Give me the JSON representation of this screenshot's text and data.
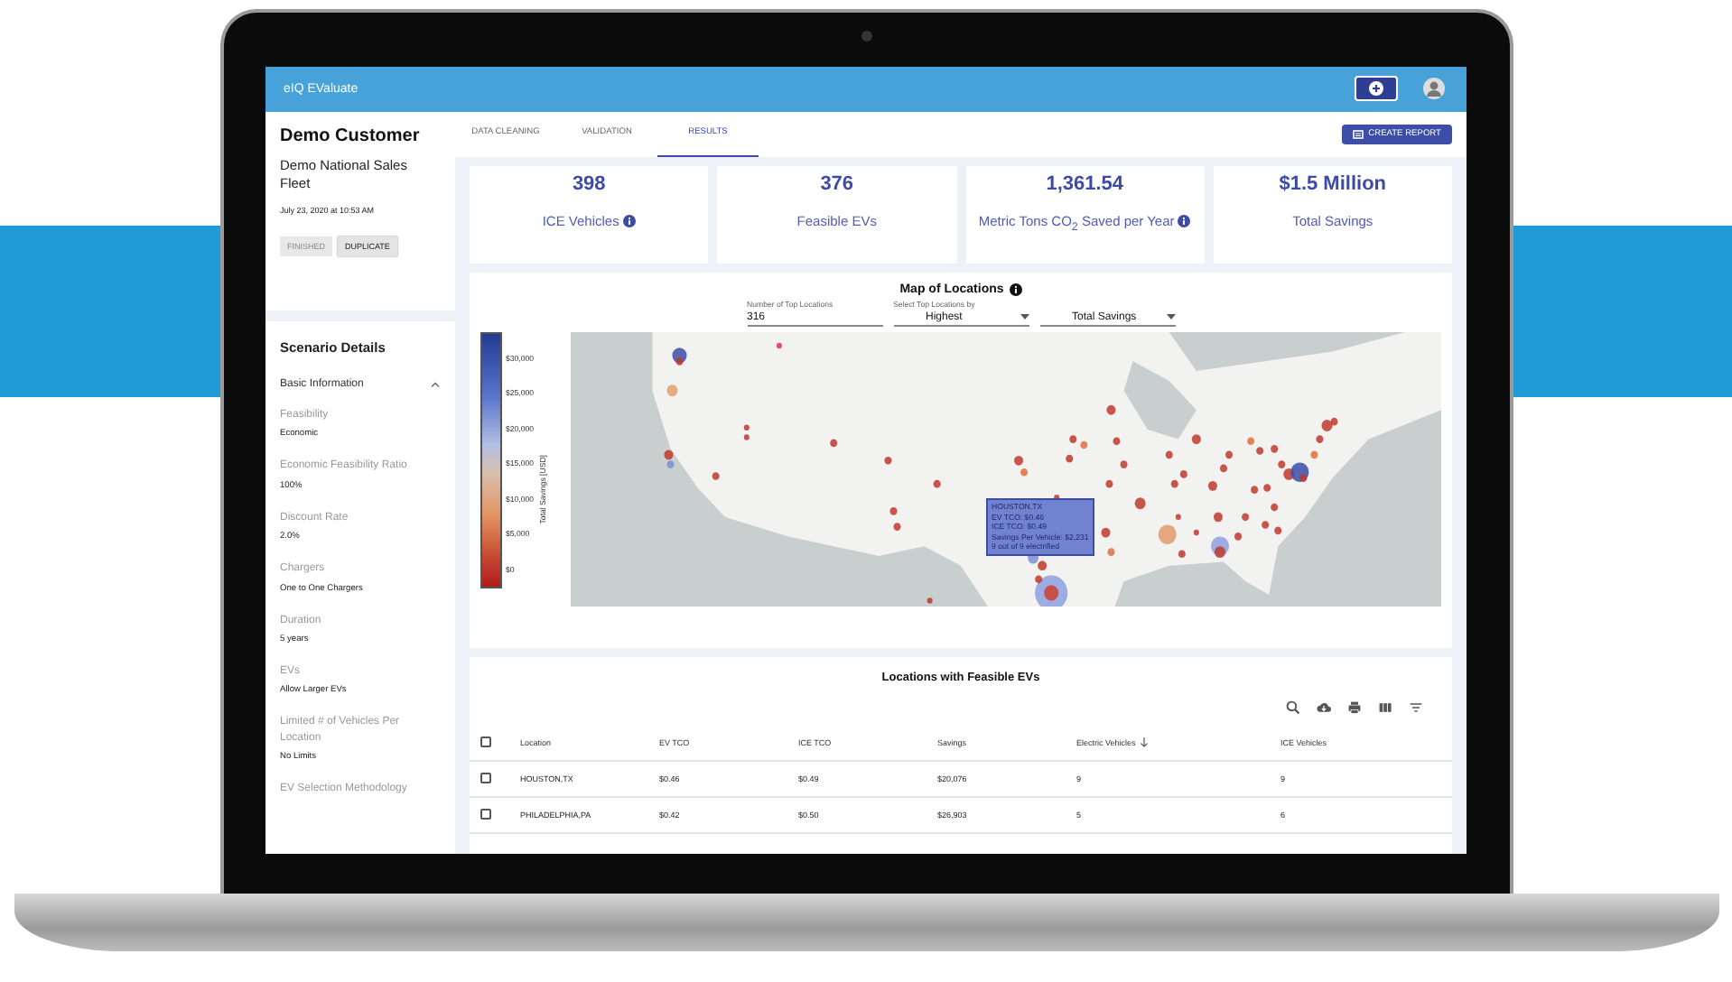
{
  "app": {
    "title": "eIQ EValuate"
  },
  "customer": {
    "name": "Demo Customer",
    "fleet": "Demo National Sales Fleet",
    "date": "July 23, 2020 at 10:53 AM"
  },
  "actions": [
    {
      "label": "FINISHED",
      "disabled": true
    },
    {
      "label": "DUPLICATE",
      "disabled": false
    }
  ],
  "scenario": {
    "title": "Scenario Details",
    "section": {
      "label": "Basic Information",
      "expanded": true
    },
    "fields": [
      {
        "label": "Feasibility",
        "value": "Economic"
      },
      {
        "label": "Economic Feasibility Ratio",
        "value": "100%"
      },
      {
        "label": "Discount Rate",
        "value": "2.0%"
      },
      {
        "label": "Chargers",
        "value": "One to One Chargers"
      },
      {
        "label": "Duration",
        "value": "5 years"
      },
      {
        "label": "EVs",
        "value": "Allow Larger EVs"
      },
      {
        "label": "Limited # of Vehicles Per Location",
        "value": "No Limits"
      },
      {
        "label": "EV Selection Methodology"
      }
    ]
  },
  "tabs": [
    {
      "label": "DATA CLEANING",
      "selected": false
    },
    {
      "label": "VALIDATION",
      "selected": false
    },
    {
      "label": "RESULTS",
      "selected": true
    }
  ],
  "create_report": "CREATE REPORT",
  "stats": [
    {
      "value": "398",
      "label": "ICE Vehicles",
      "info": true
    },
    {
      "value": "376",
      "label": "Feasible EVs",
      "info": false
    },
    {
      "value": "1,361.54",
      "label": "Metric Tons CO$_{2}$ Saved per Year",
      "info": true
    },
    {
      "value": "$1.5 Million",
      "label": "Total Savings",
      "info": false
    }
  ],
  "map": {
    "title": "Map of Locations",
    "controls": [
      {
        "kind": "input",
        "label": "Number of Top Locations",
        "value": "316"
      },
      {
        "kind": "select",
        "label": "Select Top Locations by",
        "value": "Highest"
      },
      {
        "kind": "select",
        "value": "Total Savings"
      }
    ],
    "legend": {
      "title": "Total Savings [USD]",
      "ticks": [
        "$30,000",
        "$25,000",
        "$20,000",
        "$15,000",
        "$10,000",
        "$5,000",
        "$0"
      ]
    },
    "tooltip": [
      "HOUSTON,TX",
      "EV TCO: $0.46",
      "ICE TCO: $0.49",
      "Savings Per Vehicle: $2,231",
      "9 out of 9 electrified"
    ]
  },
  "table": {
    "title": "Locations with Feasible EVs",
    "all_selected": false,
    "columns": [
      {
        "label": "Location",
        "sorted": false
      },
      {
        "label": "EV TCO",
        "sorted": false
      },
      {
        "label": "ICE TCO",
        "sorted": false
      },
      {
        "label": "Savings",
        "sorted": false
      },
      {
        "label": "Electric Vehicles",
        "sorted": true
      },
      {
        "label": "ICE Vehicles",
        "sorted": false
      }
    ],
    "rows": [
      {
        "selected": false,
        "cells": [
          "HOUSTON,TX",
          "$0.46",
          "$0.49",
          "$20,076",
          "9",
          "9"
        ]
      },
      {
        "selected": false,
        "cells": [
          "PHILADELPHIA,PA",
          "$0.42",
          "$0.50",
          "$26,903",
          "5",
          "6"
        ]
      }
    ]
  }
}
